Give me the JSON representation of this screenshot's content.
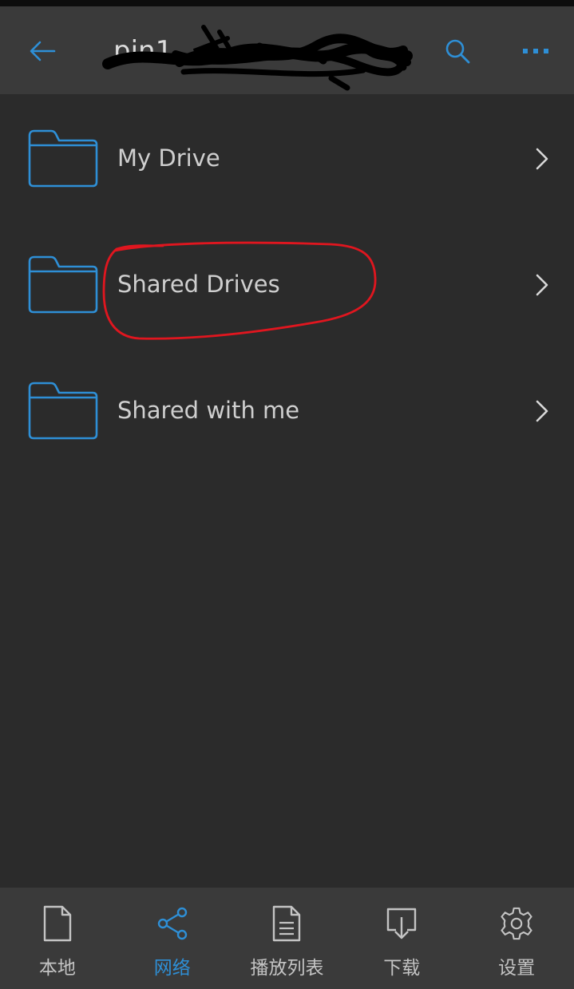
{
  "header": {
    "title": "pin1",
    "back_icon": "arrow-left-icon",
    "search_icon": "search-icon",
    "more_icon": "more-horizontal-icon"
  },
  "colors": {
    "accent": "#2e8fd6",
    "background": "#2b2b2b",
    "header_bg": "#3a3a3a",
    "annotation": "#e0161f"
  },
  "items": [
    {
      "label": "My Drive",
      "icon": "folder-icon"
    },
    {
      "label": "Shared Drives",
      "icon": "folder-icon"
    },
    {
      "label": "Shared with me",
      "icon": "folder-icon"
    }
  ],
  "nav": [
    {
      "label": "本地",
      "icon": "file-icon",
      "active": false
    },
    {
      "label": "网络",
      "icon": "share-icon",
      "active": true
    },
    {
      "label": "播放列表",
      "icon": "playlist-doc-icon",
      "active": false
    },
    {
      "label": "下载",
      "icon": "download-icon",
      "active": false
    },
    {
      "label": "设置",
      "icon": "gear-icon",
      "active": false
    }
  ]
}
